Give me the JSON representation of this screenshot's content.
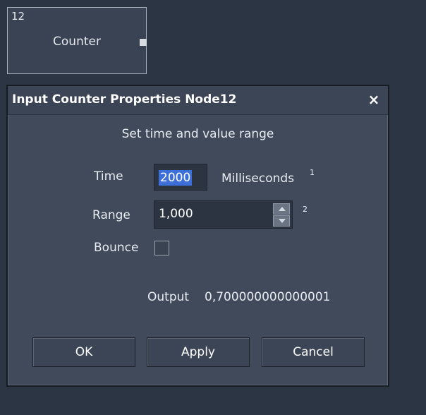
{
  "node": {
    "id": "12",
    "title": "Counter"
  },
  "dialog": {
    "title": "Input Counter Properties Node12",
    "close_glyph": "×",
    "subtitle": "Set time and value range",
    "time": {
      "label": "Time",
      "value": "2000",
      "unit": "Milliseconds",
      "note": "1"
    },
    "range": {
      "label": "Range",
      "value": "1,000",
      "note": "2"
    },
    "bounce": {
      "label": "Bounce",
      "checked": false
    },
    "output": {
      "label": "Output",
      "value": "0,700000000000001"
    },
    "buttons": {
      "ok": "OK",
      "apply": "Apply",
      "cancel": "Cancel"
    }
  }
}
